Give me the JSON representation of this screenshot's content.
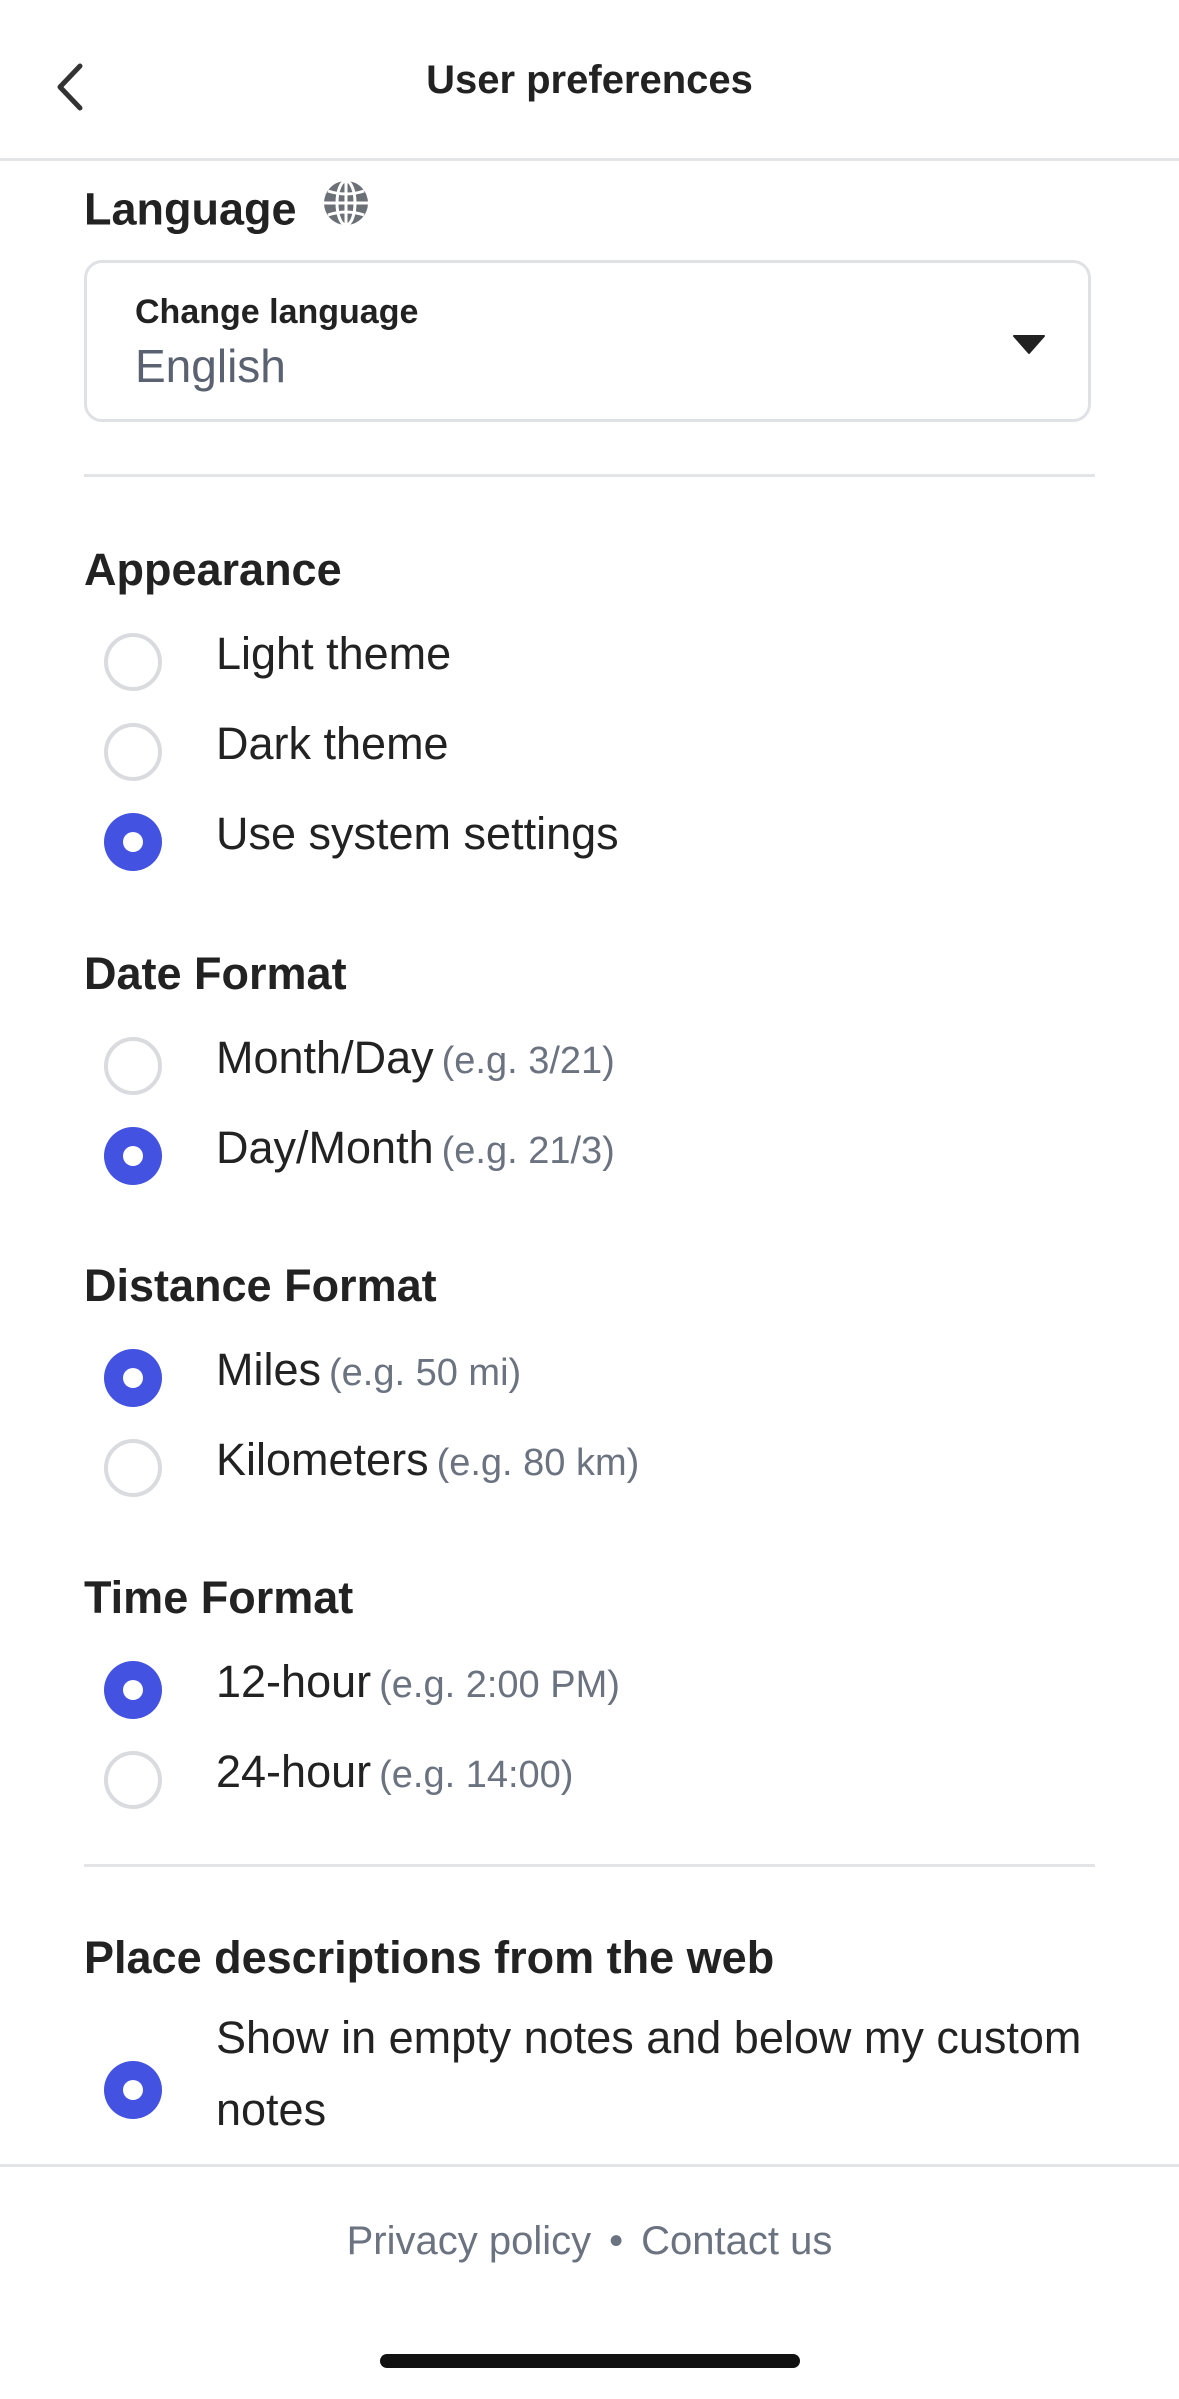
{
  "header": {
    "title": "User preferences"
  },
  "language": {
    "title": "Language",
    "select_label": "Change language",
    "select_value": "English"
  },
  "appearance": {
    "title": "Appearance",
    "options": [
      {
        "label": "Light theme",
        "checked": false
      },
      {
        "label": "Dark theme",
        "checked": false
      },
      {
        "label": "Use system settings",
        "checked": true
      }
    ]
  },
  "date_format": {
    "title": "Date Format",
    "options": [
      {
        "label": "Month/Day",
        "hint": "(e.g. 3/21)",
        "checked": false
      },
      {
        "label": "Day/Month",
        "hint": "(e.g. 21/3)",
        "checked": true
      }
    ]
  },
  "distance_format": {
    "title": "Distance Format",
    "options": [
      {
        "label": "Miles",
        "hint": "(e.g. 50 mi)",
        "checked": true
      },
      {
        "label": "Kilometers",
        "hint": "(e.g. 80 km)",
        "checked": false
      }
    ]
  },
  "time_format": {
    "title": "Time Format",
    "options": [
      {
        "label": "12-hour",
        "hint": "(e.g. 2:00 PM)",
        "checked": true
      },
      {
        "label": "24-hour",
        "hint": "(e.g. 14:00)",
        "checked": false
      }
    ]
  },
  "place_descriptions": {
    "title": "Place descriptions from the web",
    "options": [
      {
        "label": "Show in empty notes and below my custom notes",
        "checked": true
      }
    ]
  },
  "footer": {
    "privacy": "Privacy policy",
    "separator": "•",
    "contact": "Contact us"
  },
  "colors": {
    "accent": "#4352e0",
    "divider": "#e3e4e6",
    "muted": "#6b7280"
  },
  "icons": {
    "back": "chevron-left-icon",
    "globe": "globe-icon",
    "caret": "caret-down-icon"
  }
}
